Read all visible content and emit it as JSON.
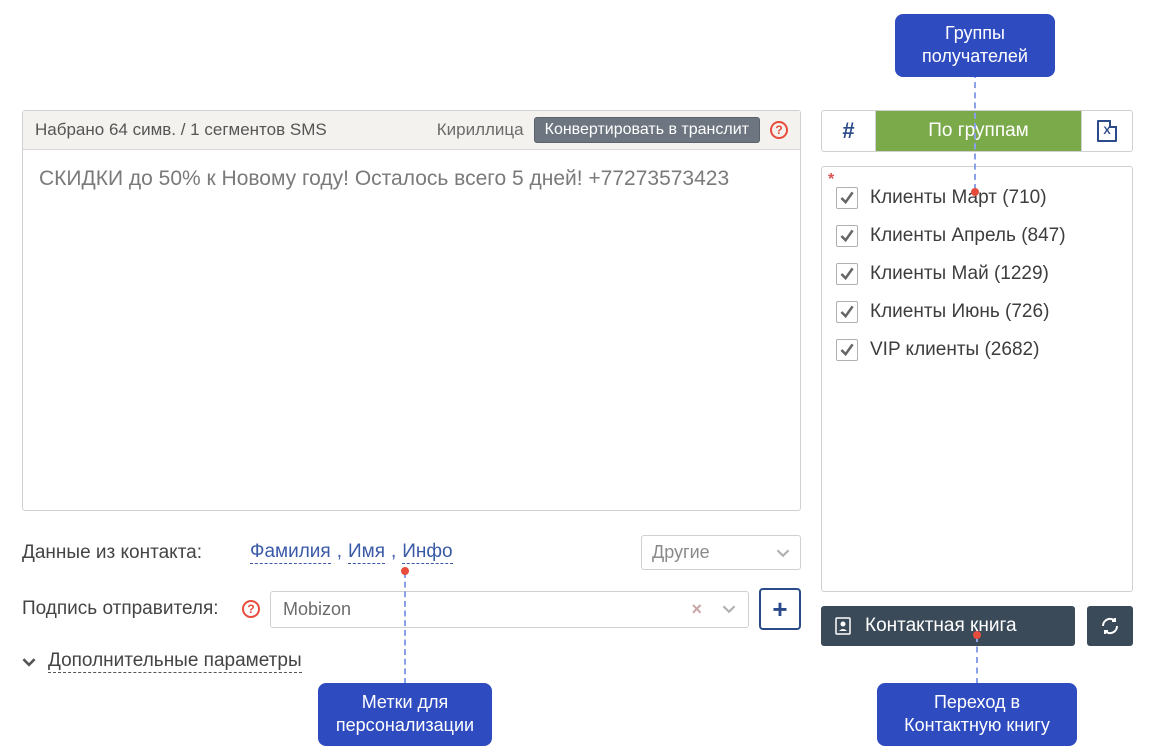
{
  "message": {
    "header_status": "Набрано 64 симв. / 1 сегментов SMS",
    "script_label": "Кириллица",
    "translit_button": "Конвертировать в транслит",
    "text": "СКИДКИ до 50% к Новому году! Осталось всего 5 дней! +77273573423"
  },
  "contact_data": {
    "label": "Данные из контакта:",
    "fields": [
      "Фамилия",
      "Имя",
      "Инфо"
    ],
    "others_label": "Другие"
  },
  "sender": {
    "label": "Подпись отправителя:",
    "value": "Mobizon"
  },
  "advanced": {
    "label": "Дополнительные параметры"
  },
  "tabs": {
    "groups_label": "По группам"
  },
  "groups": [
    {
      "label": "Клиенты Март (710)"
    },
    {
      "label": "Клиенты Апрель (847)"
    },
    {
      "label": "Клиенты Май (1229)"
    },
    {
      "label": "Клиенты Июнь (726)"
    },
    {
      "label": "VIP клиенты (2682)"
    }
  ],
  "bottom": {
    "contacts_label": "Контактная книга"
  },
  "tooltips": {
    "groups": "Группы получателей",
    "personalization": "Метки для персонализации",
    "contacts": "Переход в Контактную книгу"
  }
}
